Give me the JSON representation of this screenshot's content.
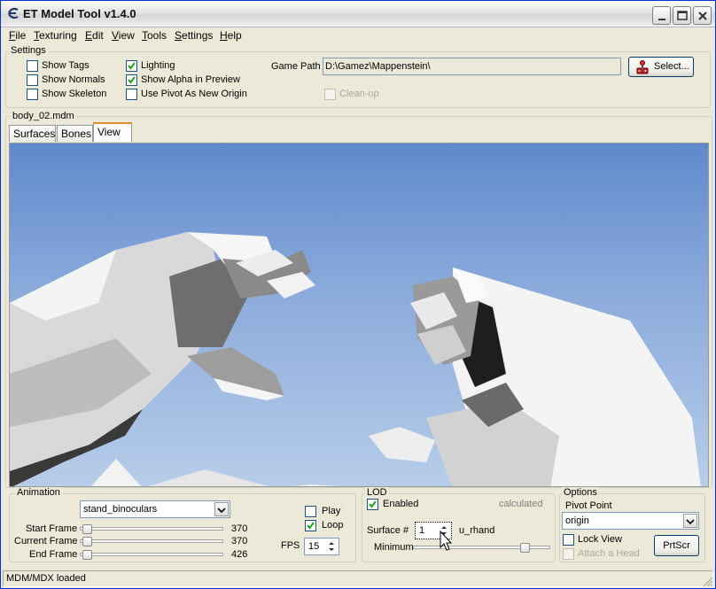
{
  "window": {
    "title": "ET Model Tool v1.4.0"
  },
  "menu": [
    "File",
    "Texturing",
    "Edit",
    "View",
    "Tools",
    "Settings",
    "Help"
  ],
  "settings": {
    "title": "Settings",
    "show_tags": {
      "label": "Show Tags",
      "checked": false
    },
    "show_normals": {
      "label": "Show Normals",
      "checked": false
    },
    "show_skeleton": {
      "label": "Show Skeleton",
      "checked": false
    },
    "lighting": {
      "label": "Lighting",
      "checked": true
    },
    "show_alpha": {
      "label": "Show Alpha in Preview",
      "checked": true
    },
    "use_pivot": {
      "label": "Use Pivot As New Origin",
      "checked": false
    },
    "game_path_label": "Game Path",
    "game_path_value": "D:\\Gamez\\Mappenstein\\",
    "select_label": "Select...",
    "cleanup": {
      "label": "Clean-up",
      "checked": false,
      "enabled": false
    }
  },
  "model_group_title": "body_02.mdm",
  "tabs": [
    "Surfaces",
    "Bones",
    "View"
  ],
  "active_tab": "View",
  "animation": {
    "title": "Animation",
    "selected": "stand_binoculars",
    "start_label": "Start Frame",
    "start_value": "370",
    "current_label": "Current Frame",
    "current_value": "370",
    "end_label": "End Frame",
    "end_value": "426",
    "play": {
      "label": "Play",
      "checked": false
    },
    "loop": {
      "label": "Loop",
      "checked": true
    },
    "fps_label": "FPS",
    "fps_value": "15"
  },
  "lod": {
    "title": "LOD",
    "enabled": {
      "label": "Enabled",
      "checked": true
    },
    "calculated_label": "calculated",
    "surface_label": "Surface #",
    "surface_value": "1",
    "surface_name": "u_rhand",
    "minimum_label": "Minimum"
  },
  "options": {
    "title": "Options",
    "pivot_label": "Pivot Point",
    "pivot_value": "origin",
    "lock_view": {
      "label": "Lock View",
      "checked": false
    },
    "attach_head": {
      "label": "Attach a Head",
      "checked": false,
      "enabled": false
    },
    "prtscr_label": "PrtScr"
  },
  "status": "MDM/MDX loaded",
  "colors": {
    "accent": "#0831d9",
    "sky_top": "#6089cc",
    "sky_bottom": "#b7cde9"
  }
}
